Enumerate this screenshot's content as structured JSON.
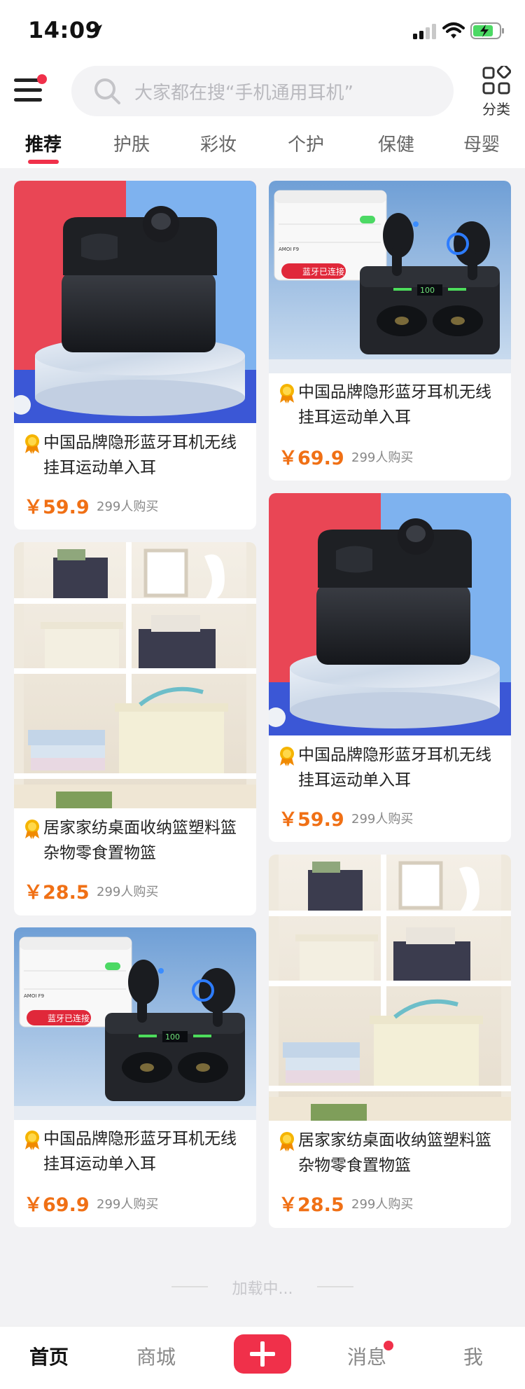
{
  "status_bar": {
    "time": "14:09"
  },
  "header": {
    "search_placeholder": "大家都在搜“手机通用耳机”",
    "category_label": "分类"
  },
  "tabs": [
    {
      "label": "推荐",
      "active": true
    },
    {
      "label": "护肤"
    },
    {
      "label": "彩妆"
    },
    {
      "label": "个护"
    },
    {
      "label": "保健"
    },
    {
      "label": "母婴"
    }
  ],
  "products": [
    {
      "image": "earbud-case-on-podium",
      "title": "中国品牌隐形蓝牙耳机无线挂耳运动单入耳",
      "price": "￥59.9",
      "buyers": "299人购买"
    },
    {
      "image": "earbuds-with-power-display",
      "title": "中国品牌隐形蓝牙耳机无线挂耳运动单入耳",
      "price": "￥69.9",
      "buyers": "299人购买",
      "image_text": {
        "bluetooth": "蓝牙已连接",
        "display": "100",
        "device": "AMOI F9"
      }
    },
    {
      "image": "storage-baskets-shelf",
      "title": "居家家纺桌面收纳篮塑料篮杂物零食置物篮",
      "price": "￥28.5",
      "buyers": "299人购买"
    },
    {
      "image": "earbud-case-on-podium",
      "title": "中国品牌隐形蓝牙耳机无线挂耳运动单入耳",
      "price": "￥59.9",
      "buyers": "299人购买"
    },
    {
      "image": "earbuds-with-power-display",
      "title": "中国品牌隐形蓝牙耳机无线挂耳运动单入耳",
      "price": "￥69.9",
      "buyers": "299人购买",
      "image_text": {
        "bluetooth": "蓝牙已连接",
        "display": "100",
        "device": "AMOI F9"
      }
    },
    {
      "image": "storage-baskets-shelf",
      "title": "居家家纺桌面收纳篮塑料篮杂物零食置物篮",
      "price": "￥28.5",
      "buyers": "299人购买"
    }
  ],
  "loading_text": "加载中...",
  "tab_bar": {
    "home": "首页",
    "mall": "商城",
    "publish": "+",
    "messages": "消息",
    "me": "我"
  },
  "colors": {
    "accent": "#f0304a",
    "price": "#f07015"
  }
}
